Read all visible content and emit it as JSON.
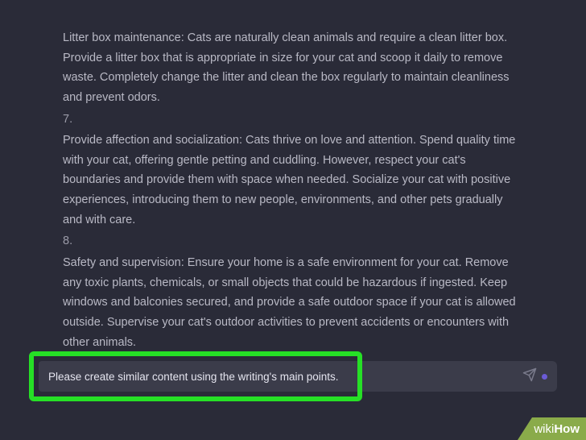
{
  "content": {
    "para_litter": "Litter box maintenance: Cats are naturally clean animals and require a clean litter box. Provide a litter box that is appropriate in size for your cat and scoop it daily to remove waste. Completely change the litter and clean the box regularly to maintain cleanliness and prevent odors.",
    "num7": "7.",
    "para_affection": "Provide affection and socialization: Cats thrive on love and attention. Spend quality time with your cat, offering gentle petting and cuddling. However, respect your cat's boundaries and provide them with space when needed. Socialize your cat with positive experiences, introducing them to new people, environments, and other pets gradually and with care.",
    "num8": "8.",
    "para_safety": "Safety and supervision: Ensure your home is a safe environment for your cat. Remove any toxic plants, chemicals, or small objects that could be hazardous if ingested. Keep windows and balconies secured, and provide a safe outdoor space if your cat is allowed outside. Supervise your cat's outdoor activities to prevent accidents or encounters with other animals."
  },
  "input": {
    "value": "Please create similar content using the writing's main points."
  },
  "badge": {
    "wiki": "wiki",
    "how": "How"
  }
}
